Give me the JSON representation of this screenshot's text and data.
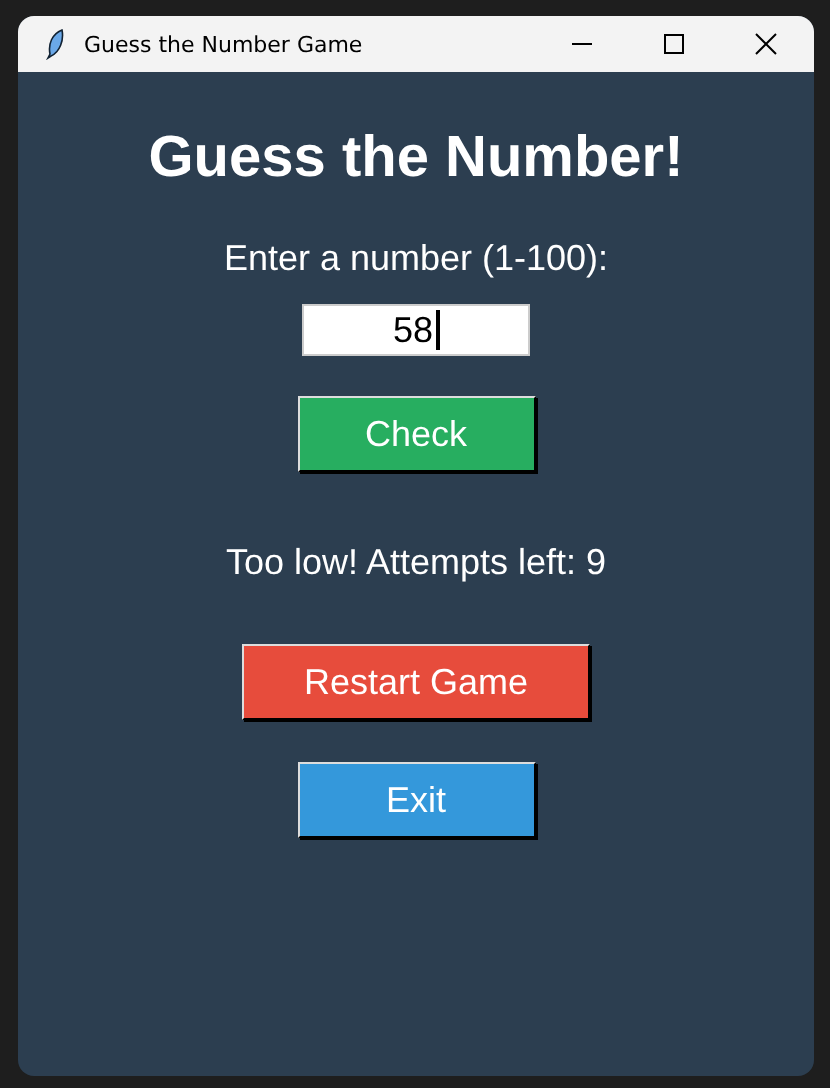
{
  "window": {
    "title": "Guess the Number Game"
  },
  "heading": "Guess the Number!",
  "prompt": "Enter a number (1-100):",
  "entry": {
    "value": "58"
  },
  "buttons": [
    {
      "label": "Check",
      "color": "#27ae60"
    },
    {
      "label": "Restart Game",
      "color": "#e74c3c"
    },
    {
      "label": "Exit",
      "color": "#3498db"
    }
  ],
  "result": "Too low! Attempts left: 9"
}
